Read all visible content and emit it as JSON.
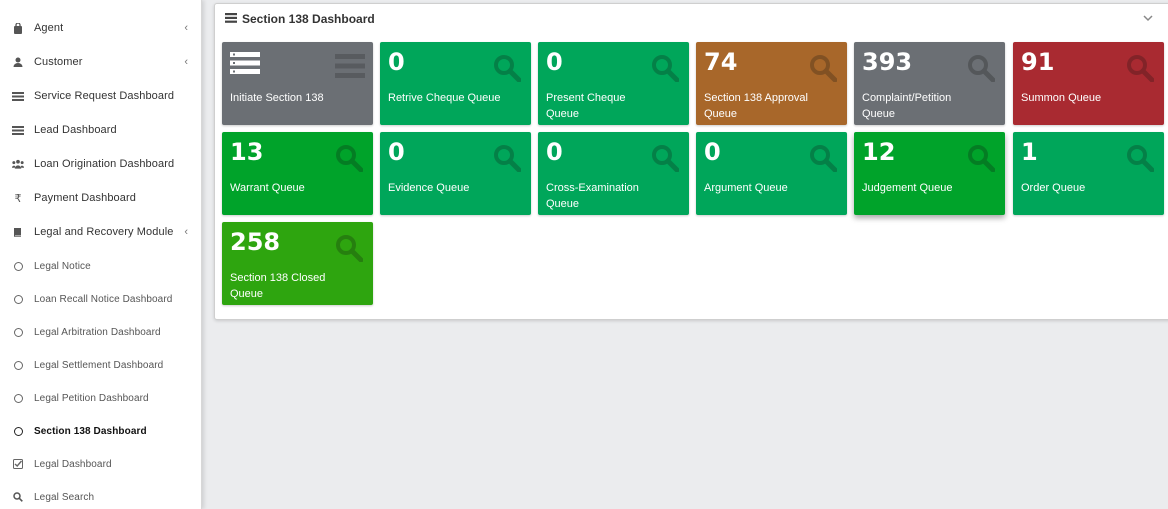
{
  "sidebar": {
    "items": [
      {
        "label": "Agent",
        "icon": "bag-icon"
      },
      {
        "label": "Customer",
        "icon": "user-icon"
      },
      {
        "label": "Service Request Dashboard",
        "icon": "list-icon"
      },
      {
        "label": "Lead Dashboard",
        "icon": "list-icon"
      },
      {
        "label": "Loan Origination Dashboard",
        "icon": "users-icon"
      },
      {
        "label": "Payment Dashboard",
        "icon": "rupee-icon"
      },
      {
        "label": "Legal and Recovery Module",
        "icon": "book-icon"
      }
    ],
    "subitems": [
      {
        "label": "Legal Notice"
      },
      {
        "label": "Loan Recall Notice Dashboard"
      },
      {
        "label": "Legal Arbitration Dashboard"
      },
      {
        "label": "Legal Settlement Dashboard"
      },
      {
        "label": "Legal Petition Dashboard"
      },
      {
        "label": "Section 138 Dashboard"
      },
      {
        "label": "Legal Dashboard"
      },
      {
        "label": "Legal Search"
      }
    ]
  },
  "dashboard": {
    "title": "Section 138 Dashboard",
    "tiles": [
      {
        "count": "",
        "label": "Initiate Section 138",
        "color": "#6b6f74"
      },
      {
        "count": "0",
        "label": "Retrive Cheque Queue",
        "color": "#00a65a"
      },
      {
        "count": "0",
        "label": "Present Cheque Queue",
        "color": "#00a65a"
      },
      {
        "count": "74",
        "label": "Section 138 Approval Queue",
        "color": "#a8672a"
      },
      {
        "count": "393",
        "label": "Complaint/Petition Queue",
        "color": "#6b6f74"
      },
      {
        "count": "91",
        "label": "Summon Queue",
        "color": "#a92a31"
      },
      {
        "count": "13",
        "label": "Warrant Queue",
        "color": "#00a32a"
      },
      {
        "count": "0",
        "label": "Evidence Queue",
        "color": "#00a65a"
      },
      {
        "count": "0",
        "label": "Cross-Examination Queue",
        "color": "#00a65a"
      },
      {
        "count": "0",
        "label": "Argument Queue",
        "color": "#00a65a"
      },
      {
        "count": "12",
        "label": "Judgement Queue",
        "color": "#00a32a"
      },
      {
        "count": "1",
        "label": "Order Queue",
        "color": "#00a65a"
      },
      {
        "count": "258",
        "label": "Section 138 Closed Queue",
        "color": "#2ea50f"
      }
    ]
  }
}
